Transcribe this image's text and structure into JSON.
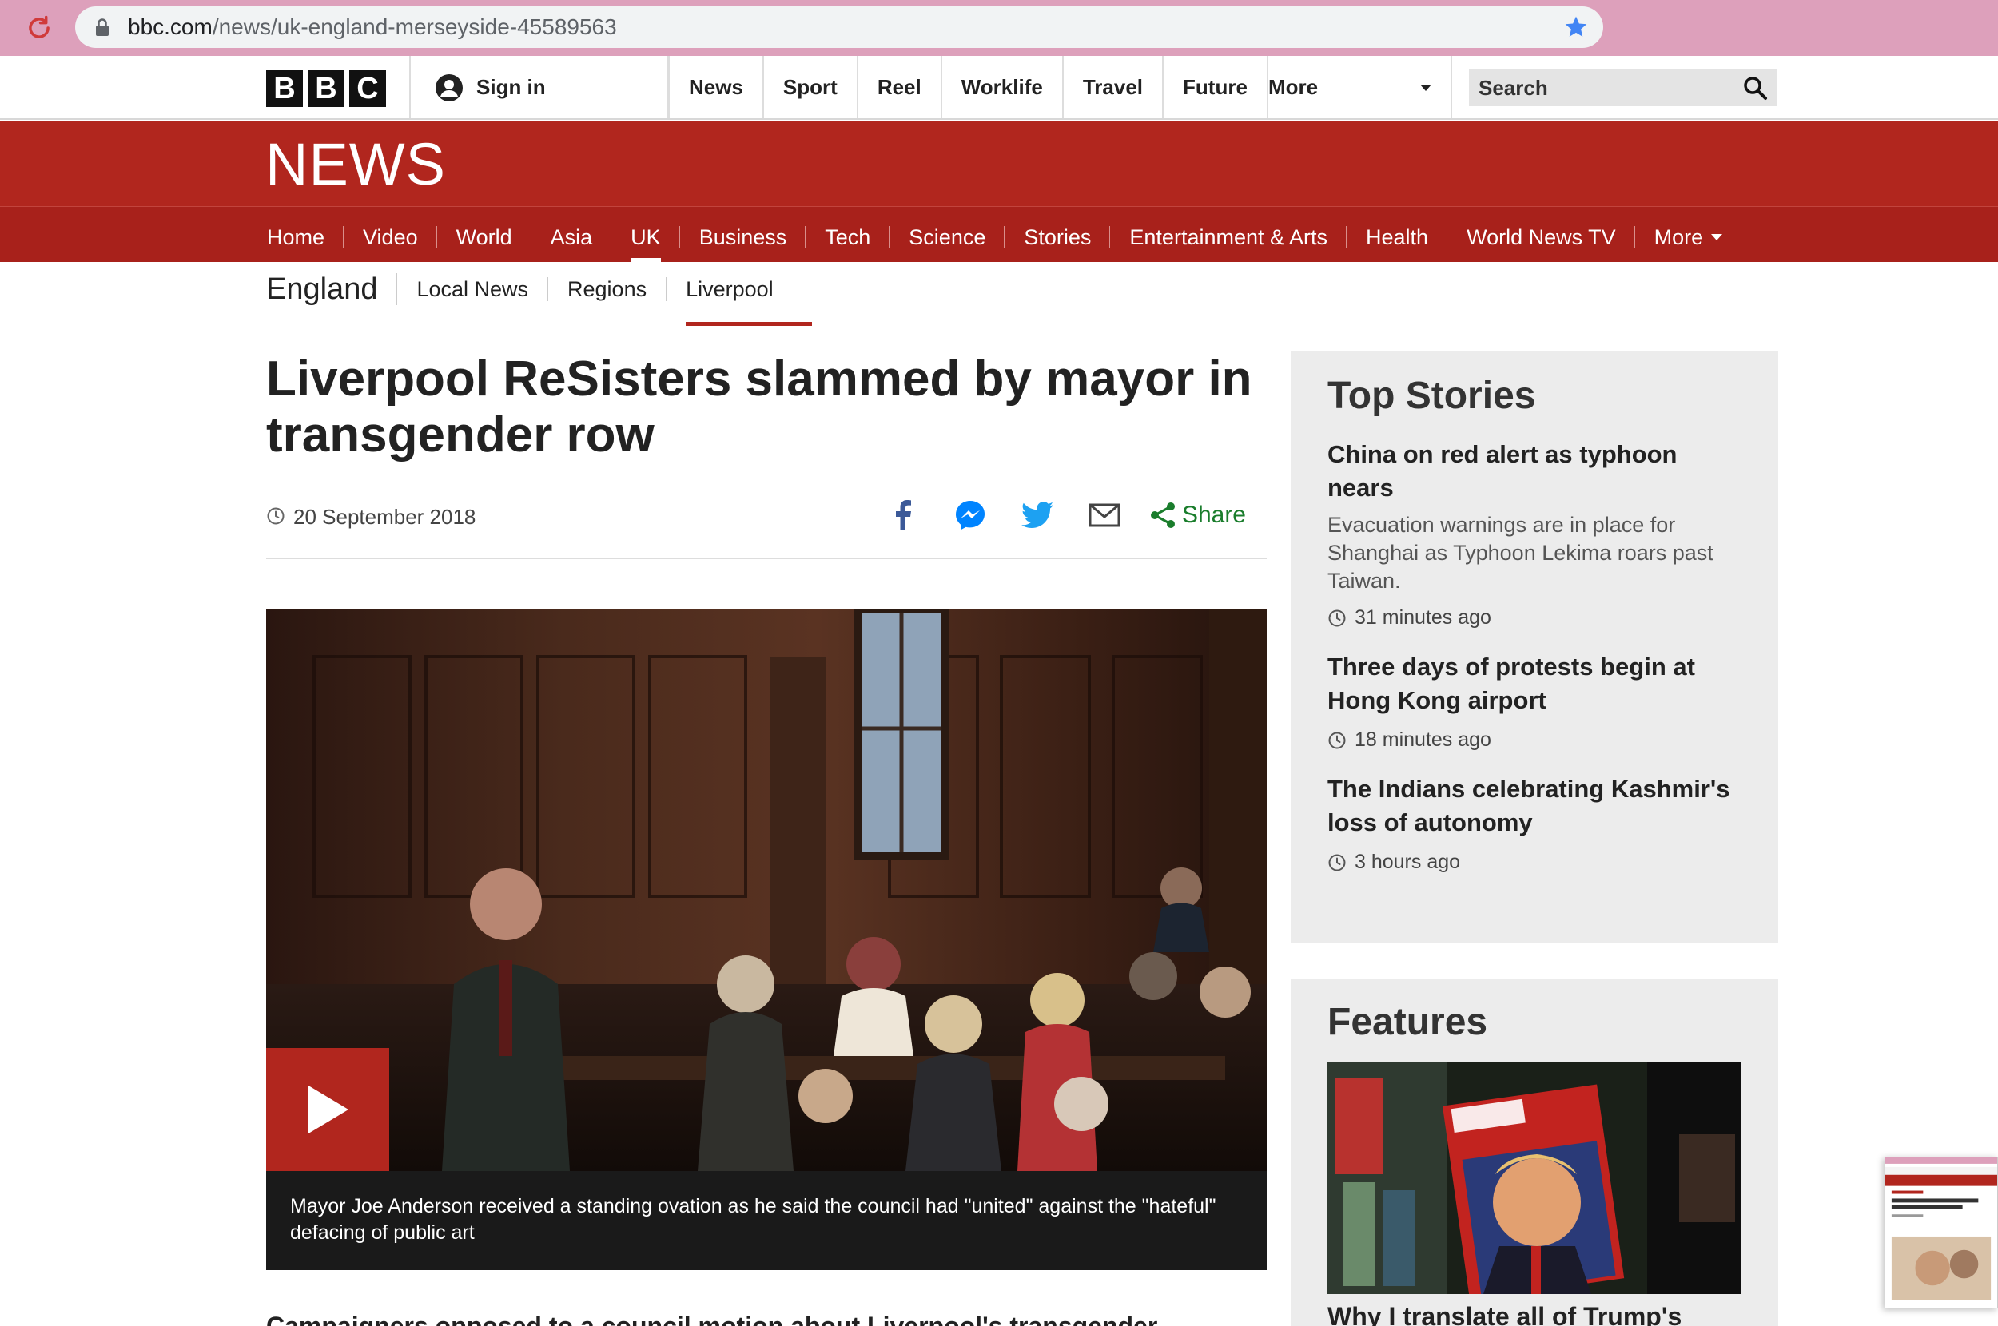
{
  "browser": {
    "url_host": "bbc.com",
    "url_path": "/news/uk-england-merseyside-45589563"
  },
  "bbc_bar": {
    "logo_letters": [
      "B",
      "B",
      "C"
    ],
    "signin_label": "Sign in",
    "nav": [
      "News",
      "Sport",
      "Reel",
      "Worklife",
      "Travel",
      "Future"
    ],
    "more_label": "More",
    "search_placeholder": "Search"
  },
  "news_banner": {
    "wordmark": "NEWS"
  },
  "news_nav": {
    "items": [
      "Home",
      "Video",
      "World",
      "Asia",
      "UK",
      "Business",
      "Tech",
      "Science",
      "Stories",
      "Entertainment & Arts",
      "Health",
      "World News TV"
    ],
    "active": "UK",
    "more_label": "More"
  },
  "sub_nav": {
    "title": "England",
    "items": [
      "Local News",
      "Regions",
      "Liverpool"
    ],
    "active": "Liverpool"
  },
  "article": {
    "headline": "Liverpool ReSisters slammed by mayor in transgender row",
    "date": "20 September 2018",
    "share_label": "Share",
    "video_caption": "Mayor Joe Anderson received a standing ovation as he said the council had \"united\" against the \"hateful\" defacing of public art",
    "body_start": "Campaigners opposed to a council motion about Liverpool's transgender"
  },
  "top_stories": {
    "title": "Top Stories",
    "stories": [
      {
        "title": "China on red alert as typhoon nears",
        "summary": "Evacuation warnings are in place for Shanghai as Typhoon Lekima roars past Taiwan.",
        "time": "31 minutes ago"
      },
      {
        "title": "Three days of protests begin at Hong Kong airport",
        "summary": "",
        "time": "18 minutes ago"
      },
      {
        "title": "The Indians celebrating Kashmir's loss of autonomy",
        "summary": "",
        "time": "3 hours ago"
      }
    ]
  },
  "features": {
    "title": "Features",
    "item_title": "Why I translate all of Trump's"
  },
  "colors": {
    "bbc_red": "#b1261e",
    "share_green": "#1a7d2c",
    "facebook_blue": "#3b5998",
    "twitter_blue": "#1da1f2",
    "messenger_blue": "#0084ff"
  }
}
